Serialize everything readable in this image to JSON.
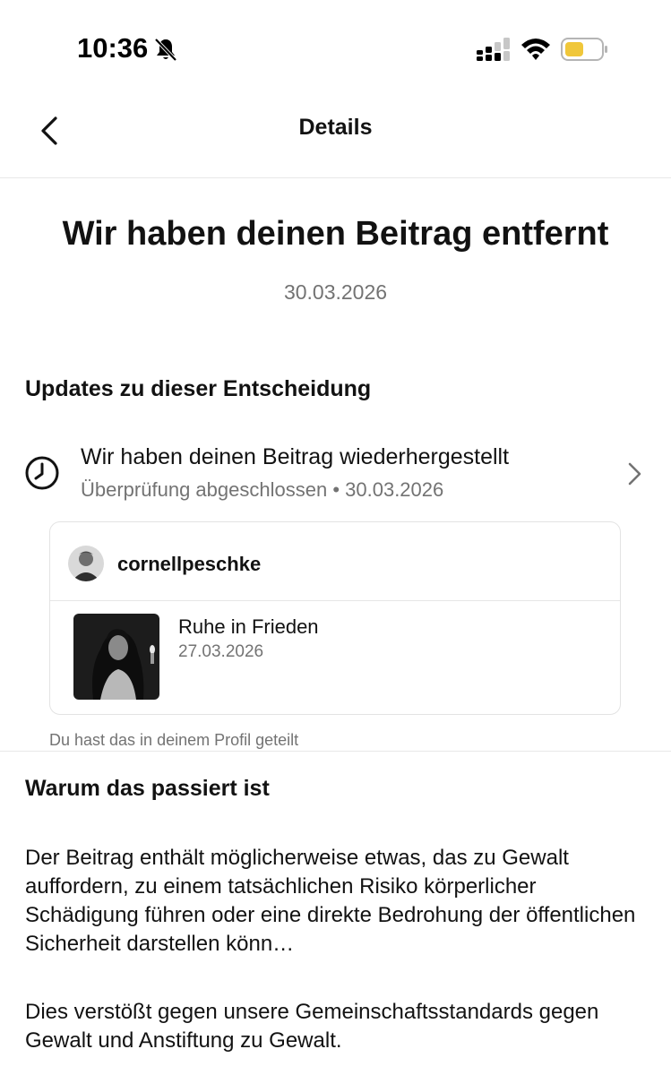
{
  "status_bar": {
    "time": "10:36",
    "icons": [
      "bell-muted-icon",
      "cellular-signal-icon",
      "wifi-icon",
      "battery-low-power-icon"
    ],
    "battery_color": "#f0c73a"
  },
  "nav": {
    "back_icon": "chevron-left-icon",
    "title": "Details"
  },
  "header": {
    "title": "Wir haben deinen Beitrag entfernt",
    "date": "30.03.2026"
  },
  "updates": {
    "heading": "Updates zu dieser Entscheidung",
    "item": {
      "icon": "clock-icon",
      "title": "Wir haben deinen Beitrag wiederhergestellt",
      "status": "Überprüfung abgeschlossen",
      "separator": "•",
      "date": "30.03.2026",
      "chevron": "chevron-right-icon"
    }
  },
  "post": {
    "username": "cornellpeschke",
    "caption": "Ruhe in Frieden",
    "date": "27.03.2026",
    "shared_note": "Du hast das in deinem Profil geteilt"
  },
  "reason": {
    "heading": "Warum das passiert ist",
    "paragraph1": "Der Beitrag enthält möglicherweise etwas, das zu Gewalt auffordern, zu einem tatsächlichen Risiko körperlicher Schädigung führen oder eine direkte Bedrohung der öffentlichen Sicherheit darstellen könn…",
    "paragraph2": "Dies verstößt gegen unsere Gemeinschaftsstandards gegen Gewalt und Anstiftung zu Gewalt."
  }
}
